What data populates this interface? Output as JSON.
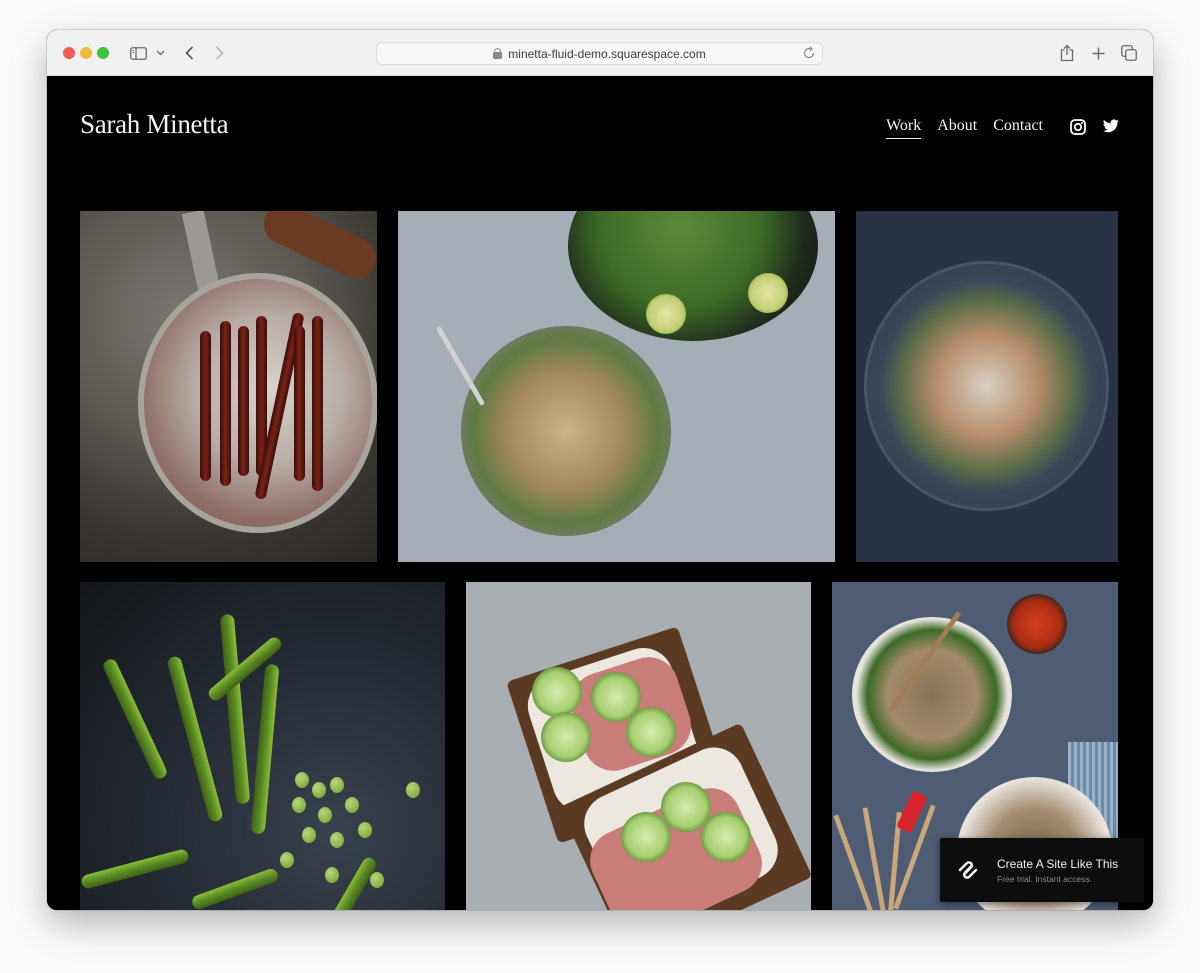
{
  "browser": {
    "url": "minetta-fluid-demo.squarespace.com",
    "icons": {
      "close": "traffic-light-close",
      "minimize": "traffic-light-minimize",
      "zoom": "traffic-light-zoom",
      "sidebar": "sidebar-icon",
      "sidebar_menu": "chevron-down-icon",
      "back": "chevron-left-icon",
      "forward": "chevron-right-icon",
      "lock": "lock-icon",
      "reload": "reload-icon",
      "share": "share-icon",
      "new_tab": "plus-icon",
      "tabs": "tabs-overview-icon"
    }
  },
  "site": {
    "title": "Sarah Minetta",
    "nav": [
      {
        "label": "Work",
        "active": true
      },
      {
        "label": "About",
        "active": false
      },
      {
        "label": "Contact",
        "active": false
      }
    ],
    "social": [
      "instagram-icon",
      "twitter-icon"
    ]
  },
  "gallery": {
    "photos": [
      {
        "subject": "Caramelized carrots in a pan"
      },
      {
        "subject": "Pho noodle bowl with herbs and lime"
      },
      {
        "subject": "Seafood pasta on a dark plate"
      },
      {
        "subject": "Fava beans and pods"
      },
      {
        "subject": "Open-faced roast beef and cucumber sandwiches"
      },
      {
        "subject": "Soba noodle bowls with mushrooms"
      }
    ]
  },
  "cta": {
    "title": "Create A Site Like This",
    "subtitle": "Free trial. Instant access.",
    "icon": "squarespace-logo-icon"
  }
}
